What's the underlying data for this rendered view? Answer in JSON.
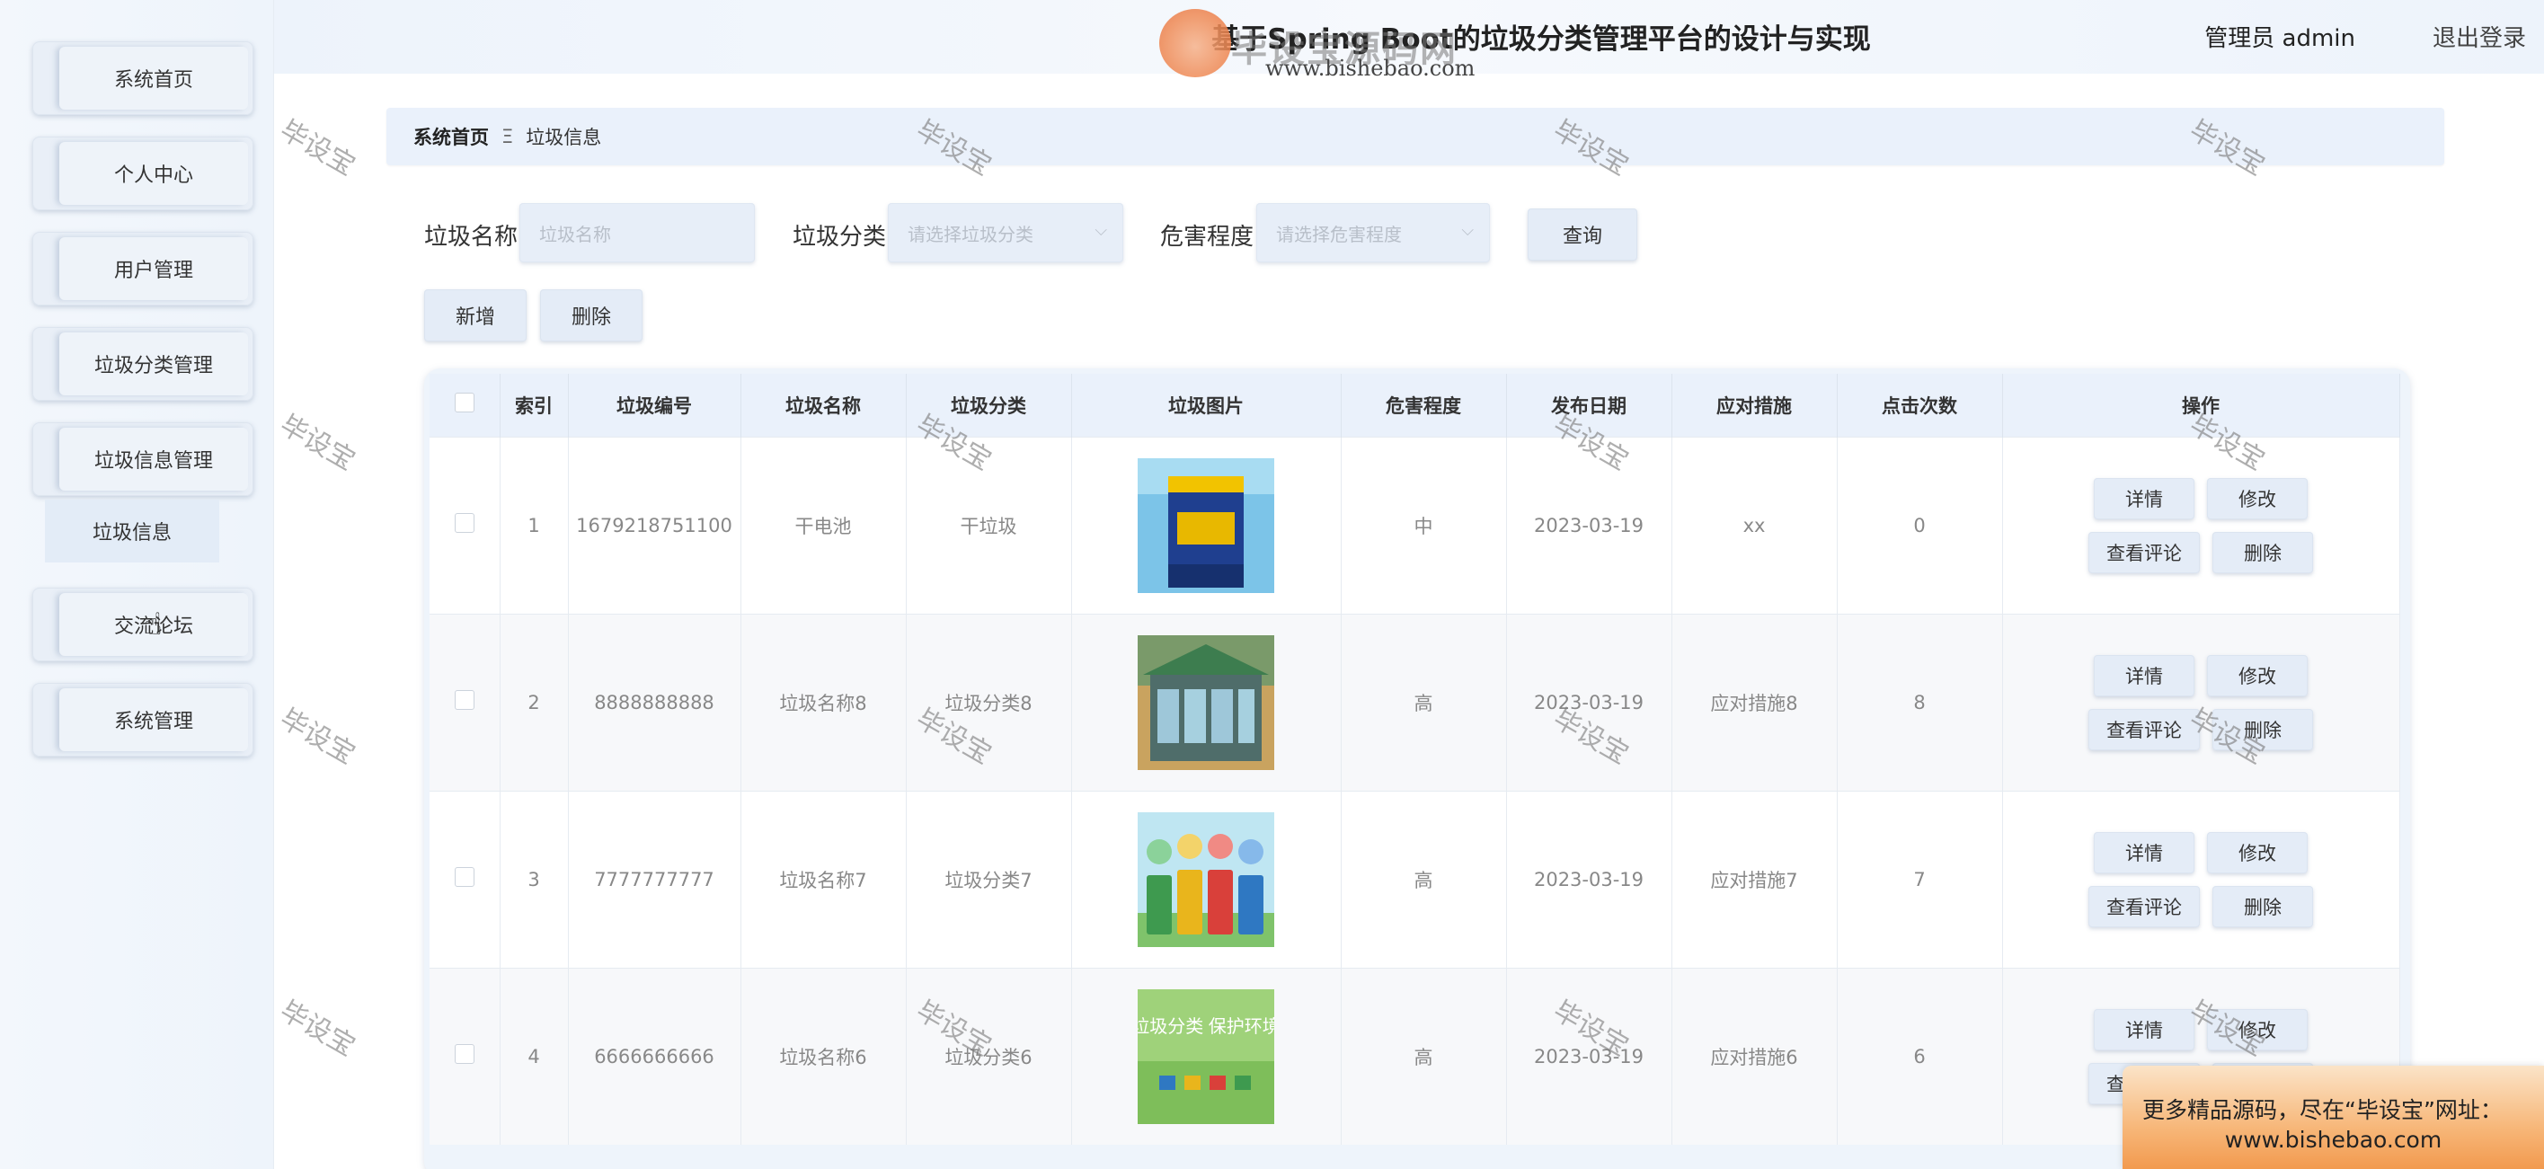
{
  "header": {
    "title": "基于Spring Boot的垃圾分类管理平台的设计与实现",
    "logo_text": "毕设宝源码网",
    "logo_url": "www.bishebao.com",
    "admin_label": "管理员 admin",
    "logout_label": "退出登录"
  },
  "sidebar": {
    "items": [
      {
        "label": "系统首页"
      },
      {
        "label": "个人中心"
      },
      {
        "label": "用户管理"
      },
      {
        "label": "垃圾分类管理"
      },
      {
        "label": "垃圾信息管理"
      },
      {
        "label": "交流论坛"
      },
      {
        "label": "系统管理"
      }
    ],
    "submenu_label": "垃圾信息"
  },
  "breadcrumb": {
    "home": "系统首页",
    "separator": "Ξ",
    "current": "垃圾信息"
  },
  "search": {
    "name_label": "垃圾名称",
    "name_placeholder": "垃圾名称",
    "category_label": "垃圾分类",
    "category_placeholder": "请选择垃圾分类",
    "level_label": "危害程度",
    "level_placeholder": "请选择危害程度",
    "query_label": "查询"
  },
  "actions": {
    "add_label": "新增",
    "delete_label": "删除"
  },
  "table": {
    "columns": [
      "索引",
      "垃圾编号",
      "垃圾名称",
      "垃圾分类",
      "垃圾图片",
      "危害程度",
      "发布日期",
      "应对措施",
      "点击次数",
      "操作"
    ],
    "op_labels": {
      "detail": "详情",
      "edit": "修改",
      "comments": "查看评论",
      "delete": "删除"
    },
    "rows": [
      {
        "index": "1",
        "code": "1679218751100",
        "name": "干电池",
        "category": "干垃圾",
        "image": "battery",
        "level": "中",
        "date": "2023-03-19",
        "measure": "xx",
        "clicks": "0"
      },
      {
        "index": "2",
        "code": "8888888888",
        "name": "垃圾名称8",
        "category": "垃圾分类8",
        "image": "kiosk",
        "level": "高",
        "date": "2023-03-19",
        "measure": "应对措施8",
        "clicks": "8"
      },
      {
        "index": "3",
        "code": "7777777777",
        "name": "垃圾名称7",
        "category": "垃圾分类7",
        "image": "bins",
        "level": "高",
        "date": "2023-03-19",
        "measure": "应对措施7",
        "clicks": "7"
      },
      {
        "index": "4",
        "code": "6666666666",
        "name": "垃圾名称6",
        "category": "垃圾分类6",
        "image": "poster",
        "level": "高",
        "date": "2023-03-19",
        "measure": "应对措施6",
        "clicks": "6"
      }
    ],
    "poster_text": "垃圾分类 保护环境"
  },
  "watermark": "毕设宝",
  "ad": {
    "line1": "更多精品源码，尽在“毕设宝”网址：",
    "line2": "www.bishebao.com"
  }
}
